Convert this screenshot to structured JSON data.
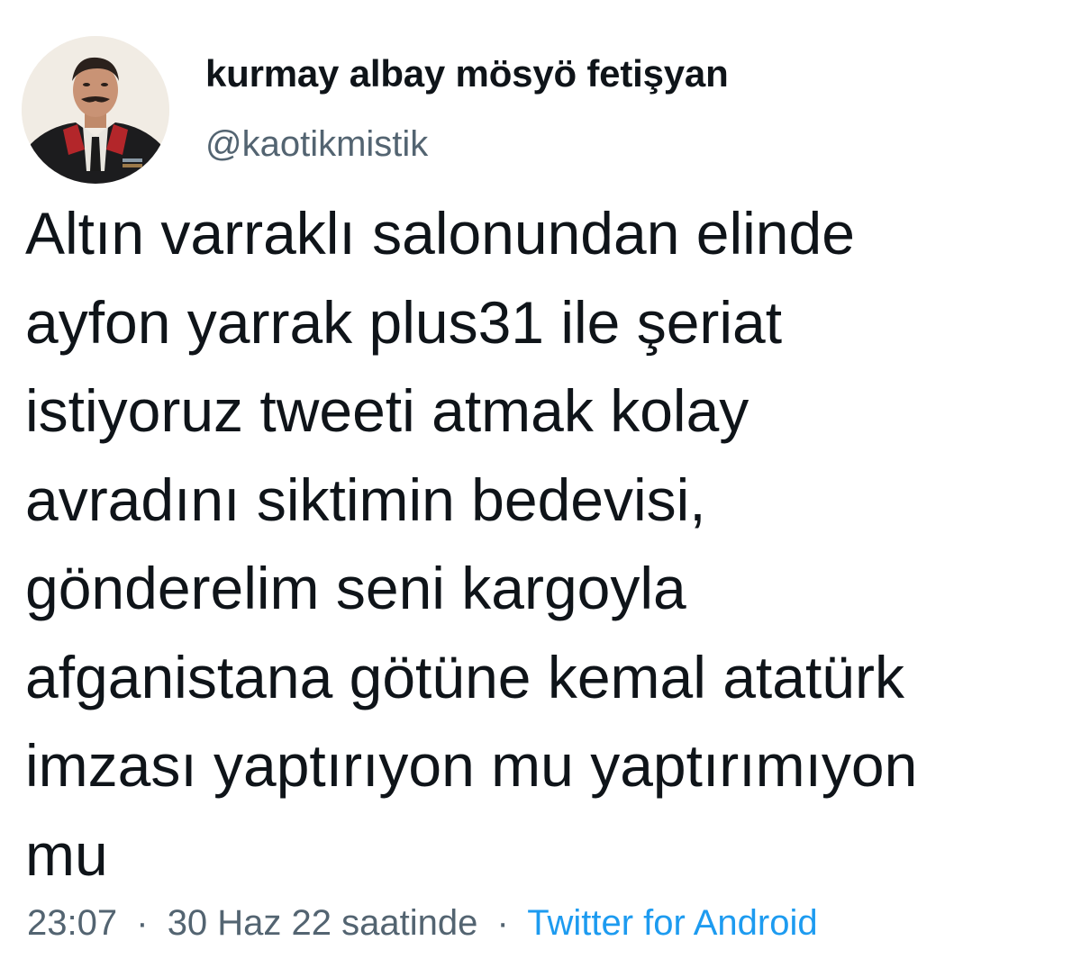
{
  "tweet": {
    "author": {
      "display_name": "kurmay albay mösyö fetişyan",
      "handle": "@kaotikmistik",
      "avatar_icon": "profile-photo-officer-in-uniform"
    },
    "text_lines": [
      "Altın varraklı salonundan elinde",
      "ayfon yarrak plus31 ile şeriat",
      "istiyoruz tweeti atmak kolay",
      "avradını siktimin bedevisi,",
      "gönderelim seni kargoyla",
      "afganistana götüne kemal atatürk",
      "imzası yaptırıyon mu yaptırımıyon",
      "mu"
    ],
    "meta": {
      "time": "23:07",
      "separator": "·",
      "date": "30 Haz 22 saatinde",
      "source": "Twitter for Android"
    }
  },
  "colors": {
    "text": "#0f1419",
    "secondary": "#536471",
    "link": "#1d9bf0",
    "background": "#ffffff"
  }
}
